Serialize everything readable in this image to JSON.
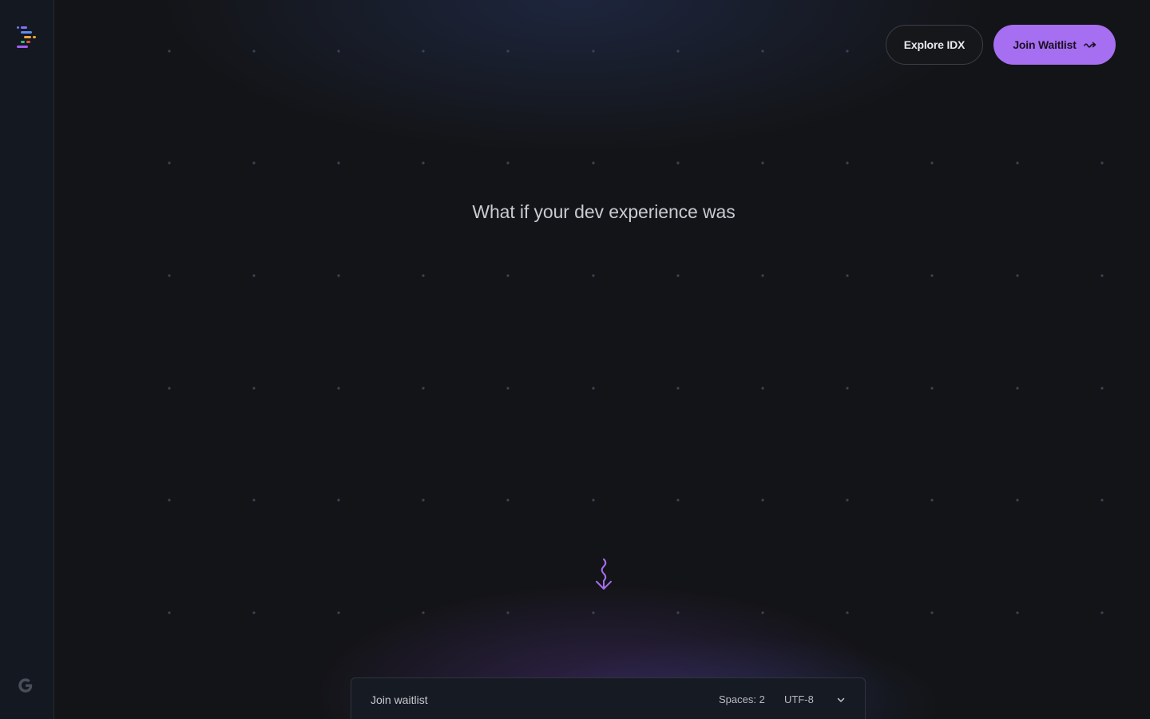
{
  "header": {
    "explore_label": "Explore IDX",
    "join_label": "Join Waitlist"
  },
  "hero": {
    "headline": "What if your dev experience was"
  },
  "statusbar": {
    "label": "Join waitlist",
    "spaces": "Spaces: 2",
    "encoding": "UTF-8"
  },
  "icons": {
    "logo": "idx-logo-icon",
    "google": "google-g-icon",
    "join_arrow": "squiggle-arrow-right-icon",
    "scroll": "squiggle-arrow-down-icon",
    "chevron": "chevron-down-icon"
  },
  "colors": {
    "accent": "#a66ef0",
    "background": "#131417",
    "rail": "#141820"
  }
}
